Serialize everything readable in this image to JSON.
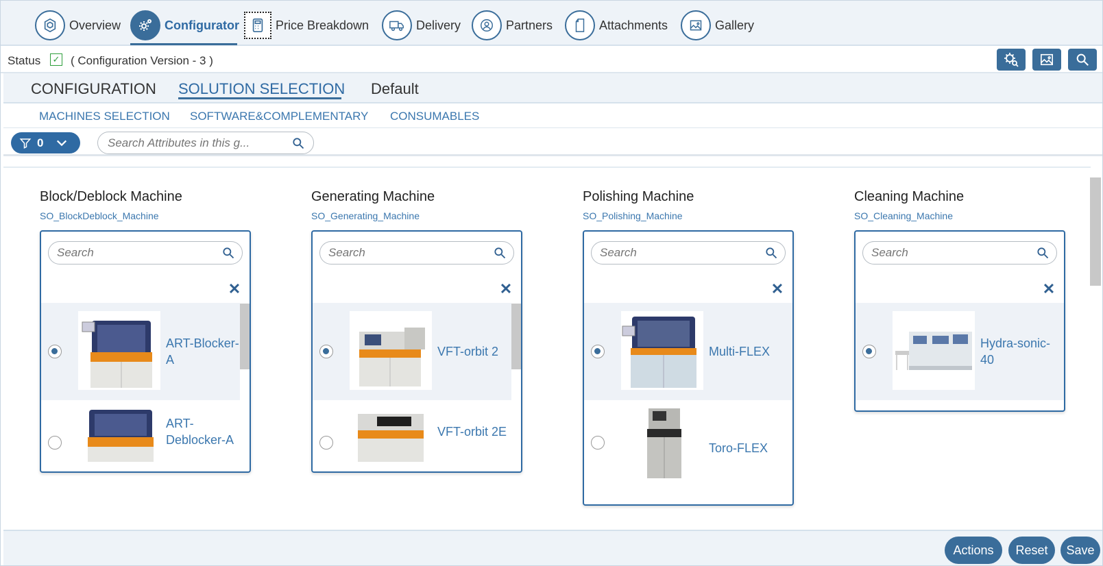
{
  "nav": {
    "tabs": [
      {
        "label": "Overview",
        "icon": "cube-icon"
      },
      {
        "label": "Configurator",
        "icon": "gears-icon"
      },
      {
        "label": "Price Breakdown",
        "icon": "calculator-icon"
      },
      {
        "label": "Delivery",
        "icon": "truck-icon"
      },
      {
        "label": "Partners",
        "icon": "user-icon"
      },
      {
        "label": "Attachments",
        "icon": "document-icon"
      },
      {
        "label": "Gallery",
        "icon": "image-icon"
      }
    ],
    "active": "Configurator"
  },
  "status": {
    "label": "Status",
    "version": "( Configuration Version - 3 )",
    "checked": true
  },
  "toolbar": {
    "buttons": [
      "settings-search-icon",
      "image-icon",
      "search-icon"
    ]
  },
  "subtabs": {
    "items": [
      "CONFIGURATION",
      "SOLUTION SELECTION",
      "Default"
    ],
    "active": "SOLUTION SELECTION"
  },
  "grouptabs": {
    "items": [
      "MACHINES SELECTION",
      "SOFTWARE&COMPLEMENTARY",
      "CONSUMABLES"
    ]
  },
  "filter": {
    "count": "0",
    "search_placeholder": "Search Attributes in this g..."
  },
  "columns": [
    {
      "title": "Block/Deblock Machine",
      "code": "SO_BlockDeblock_Machine",
      "search_placeholder": "Search",
      "options": [
        {
          "label": "ART-Blocker-A",
          "selected": true
        },
        {
          "label": "ART-Deblocker-A",
          "selected": false
        }
      ]
    },
    {
      "title": "Generating Machine",
      "code": "SO_Generating_Machine",
      "search_placeholder": "Search",
      "options": [
        {
          "label": "VFT-orbit 2",
          "selected": true
        },
        {
          "label": "VFT-orbit 2E",
          "selected": false
        }
      ]
    },
    {
      "title": "Polishing Machine",
      "code": "SO_Polishing_Machine",
      "search_placeholder": "Search",
      "options": [
        {
          "label": "Multi-FLEX",
          "selected": true
        },
        {
          "label": "Toro-FLEX",
          "selected": false
        }
      ]
    },
    {
      "title": "Cleaning Machine",
      "code": "SO_Cleaning_Machine",
      "search_placeholder": "Search",
      "options": [
        {
          "label": "Hydra-sonic-40",
          "selected": true
        }
      ]
    }
  ],
  "footer": {
    "actions": "Actions",
    "reset": "Reset",
    "save": "Save"
  },
  "colors": {
    "accent": "#3a6d9a",
    "link": "#3b77ae",
    "panel": "#eef3f8",
    "machine_orange": "#e88a1a"
  }
}
